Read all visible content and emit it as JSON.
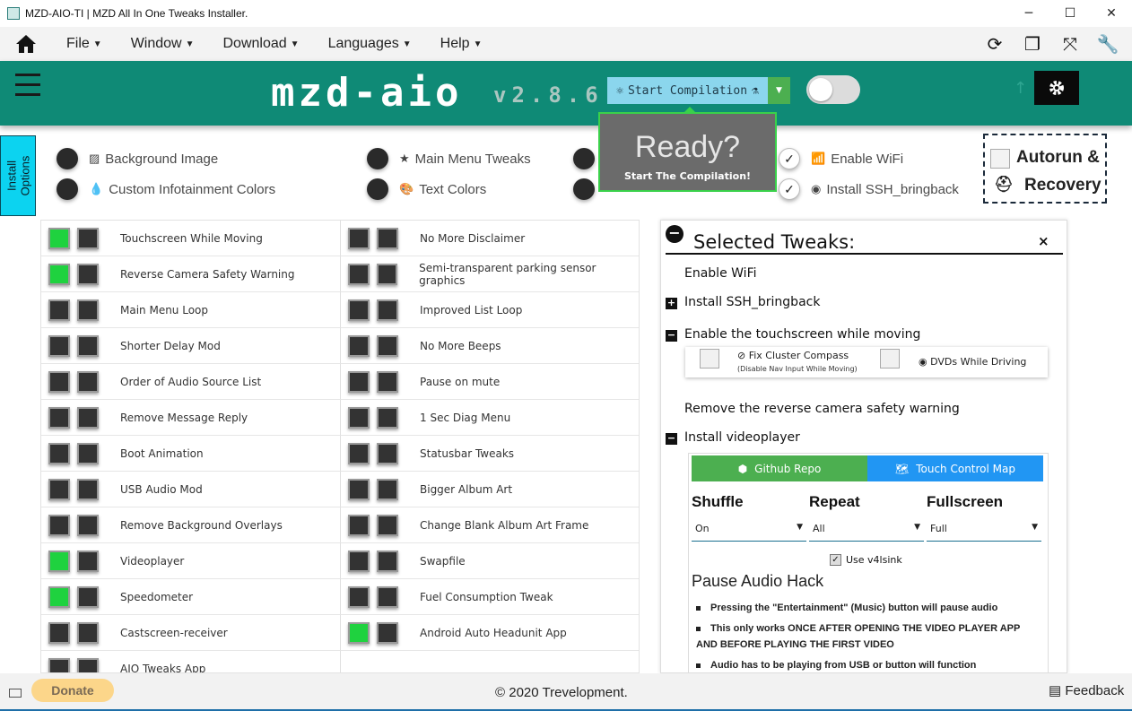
{
  "window": {
    "title": "MZD-AIO-TI | MZD All In One Tweaks Installer.",
    "minimize": "─",
    "maximize": "☐",
    "close": "✕"
  },
  "menu": {
    "items": [
      "File",
      "Window",
      "Download",
      "Languages",
      "Help"
    ]
  },
  "header": {
    "logo": "mzd-aio",
    "version": "v2.8.6",
    "compile_label": "Start Compilation"
  },
  "ready": {
    "title": "Ready?",
    "subtitle": "Start The Compilation!"
  },
  "install_tab": {
    "line1": "Install",
    "line2": "Options"
  },
  "options": {
    "background_image": "Background Image",
    "custom_colors": "Custom Infotainment Colors",
    "main_menu_tweaks": "Main Menu Tweaks",
    "text_colors": "Text Colors",
    "enable_wifi": "Enable WiFi",
    "install_ssh": "Install SSH_bringback"
  },
  "autorun": {
    "line1": "Autorun &",
    "line2": "Recovery"
  },
  "tweaks_left": [
    {
      "label": "Touchscreen While Moving",
      "on": true
    },
    {
      "label": "Reverse Camera Safety Warning",
      "on": true
    },
    {
      "label": "Main Menu Loop",
      "on": false
    },
    {
      "label": "Shorter Delay Mod",
      "on": false
    },
    {
      "label": "Order of Audio Source List",
      "on": false
    },
    {
      "label": "Remove Message Reply",
      "on": false
    },
    {
      "label": "Boot Animation",
      "on": false
    },
    {
      "label": "USB Audio Mod",
      "on": false
    },
    {
      "label": "Remove Background Overlays",
      "on": false
    },
    {
      "label": "Videoplayer",
      "on": true
    },
    {
      "label": "Speedometer",
      "on": true
    },
    {
      "label": "Castscreen-receiver",
      "on": false
    },
    {
      "label": "AIO Tweaks App",
      "on": false
    }
  ],
  "tweaks_right": [
    {
      "label": "No More Disclaimer",
      "on": false
    },
    {
      "label": "Semi-transparent parking sensor graphics",
      "on": false
    },
    {
      "label": "Improved List Loop",
      "on": false
    },
    {
      "label": "No More Beeps",
      "on": false
    },
    {
      "label": "Pause on mute",
      "on": false
    },
    {
      "label": "1 Sec Diag Menu",
      "on": false
    },
    {
      "label": "Statusbar Tweaks",
      "on": false
    },
    {
      "label": "Bigger Album Art",
      "on": false
    },
    {
      "label": "Change Blank Album Art Frame",
      "on": false
    },
    {
      "label": "Swapfile",
      "on": false
    },
    {
      "label": "Fuel Consumption Tweak",
      "on": false
    },
    {
      "label": "Android Auto Headunit App",
      "on": true
    }
  ],
  "panel": {
    "title": "Selected Tweaks:",
    "close": "×",
    "item1": "Enable WiFi",
    "item2": "Install SSH_bringback",
    "item3": "Enable the touchscreen while moving",
    "fix_compass": "Fix Cluster Compass",
    "fix_compass_note": "(Disable Nav Input While Moving)",
    "dvds": "DVDs While Driving",
    "item4": "Remove the reverse camera safety warning",
    "item5": "Install videoplayer",
    "github": "Github Repo",
    "touch_map": "Touch Control Map",
    "shuffle": "Shuffle",
    "repeat": "Repeat",
    "fullscreen": "Fullscreen",
    "shuffle_val": "On",
    "repeat_val": "All",
    "fullscreen_val": "Full",
    "v4l": "Use v4lsink",
    "pause_hack": "Pause Audio Hack",
    "bullet1": "Pressing the \"Entertainment\" (Music) button will pause audio",
    "bullet2": "This only works ONCE AFTER OPENING THE VIDEO PLAYER APP AND BEFORE PLAYING THE FIRST VIDEO",
    "bullet3": "Audio has to be playing from USB or button will function"
  },
  "footer": {
    "donate": "Donate",
    "copyright": "2020 Trevelopment.",
    "feedback": "Feedback"
  },
  "colors": {
    "header": "#0f8a76",
    "install_tab": "#0cd3f0",
    "toggle_on": "#1fd23f",
    "compile": "#8bd6ed",
    "github": "#4caf50",
    "touchmap": "#2196f3",
    "donate": "#fcd68a"
  }
}
